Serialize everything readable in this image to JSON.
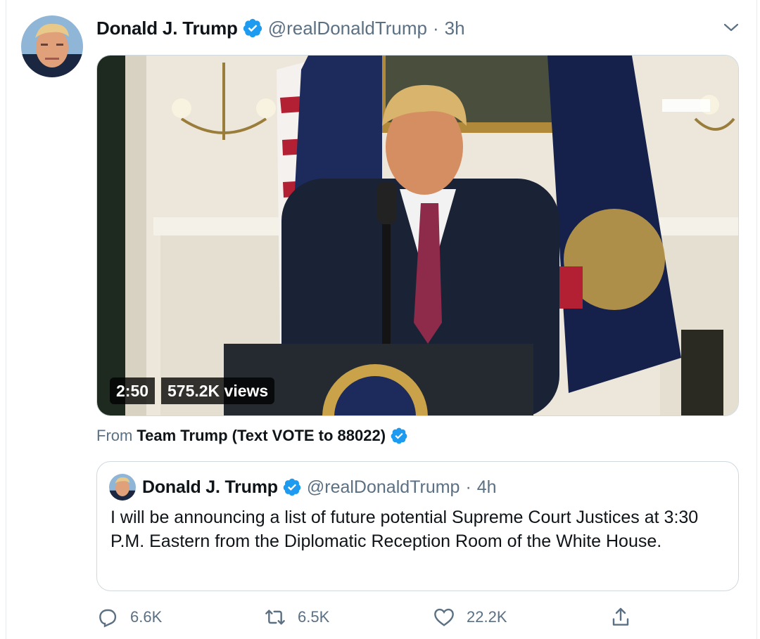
{
  "tweet": {
    "author_name": "Donald J. Trump",
    "handle": "@realDonaldTrump",
    "separator": "·",
    "time": "3h",
    "video": {
      "duration": "2:50",
      "views": "575.2K views"
    },
    "from_label": "From",
    "from_source": "Team Trump (Text VOTE to 88022)",
    "quoted": {
      "author_name": "Donald J. Trump",
      "handle": "@realDonaldTrump",
      "separator": "·",
      "time": "4h",
      "text": "I will be announcing a list of future potential Supreme Court Justices at 3:30 P.M. Eastern from the Diplomatic Reception Room of the White House."
    },
    "actions": {
      "replies": "6.6K",
      "retweets": "6.5K",
      "likes": "22.2K"
    }
  },
  "colors": {
    "verified_blue": "#1d9bf0",
    "secondary_text": "#5b7083",
    "primary_text": "#0f1419",
    "border": "#cfd9de"
  },
  "icons": {
    "verified": "verified-badge-icon",
    "caret": "chevron-down-icon",
    "reply": "reply-icon",
    "retweet": "retweet-icon",
    "like": "heart-icon",
    "share": "share-icon"
  }
}
